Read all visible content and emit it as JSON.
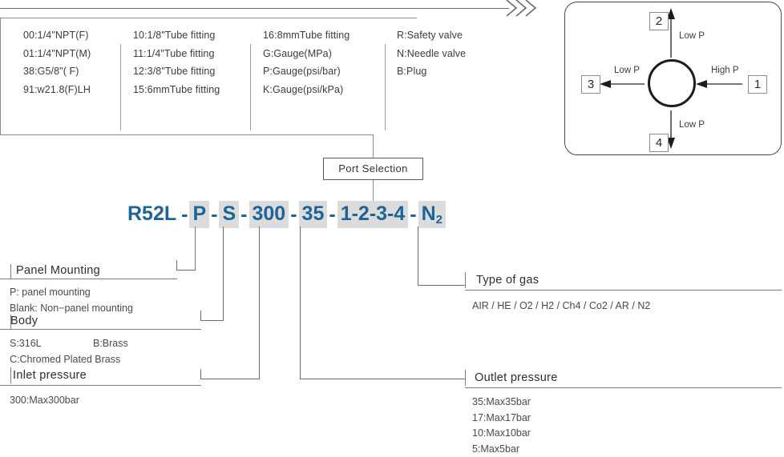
{
  "top_arrow": {
    "name": "flow-direction-arrow"
  },
  "options_table": {
    "columns": [
      {
        "header_none": true,
        "cells": [
          "00:1/4\"NPT(F)",
          "01:1/4\"NPT(M)",
          "38:G5/8\"( F)",
          "91:w21.8(F)LH"
        ]
      },
      {
        "header_none": true,
        "cells": [
          "10:1/8\"Tube fitting",
          "11:1/4\"Tube fitting",
          "12:3/8\"Tube fitting",
          "15:6mmTube fitting"
        ]
      },
      {
        "header_none": true,
        "cells": [
          "16:8mmTube fitting",
          "G:Gauge(MPa)",
          "P:Gauge(psi/bar)",
          "K:Gauge(psi/kPa)"
        ]
      },
      {
        "header_none": true,
        "cells": [
          "R:Safety valve",
          "N:Needle valve",
          "B:Plug"
        ]
      }
    ]
  },
  "schematic": {
    "ports": [
      {
        "id": "2",
        "label": "Low P"
      },
      {
        "id": "1",
        "label": "High P"
      },
      {
        "id": "3",
        "label": "Low P"
      },
      {
        "id": "4",
        "label": "Low P"
      }
    ],
    "center": "valve-body-circle"
  },
  "port_selection": {
    "label": "Port Selection"
  },
  "part_number": {
    "full": "R52L-P-S-300-35-1-2-3-4-N2",
    "segments": [
      {
        "text": "R52L",
        "highlight": false
      },
      {
        "text": "P",
        "highlight": true
      },
      {
        "text": "S",
        "highlight": true
      },
      {
        "text": "300",
        "highlight": true
      },
      {
        "text": "35",
        "highlight": true
      },
      {
        "text": "1-2-3-4",
        "highlight": true
      },
      {
        "text": "N",
        "sub": "2",
        "highlight": true
      }
    ],
    "separator": "-"
  },
  "callouts": {
    "panel_mounting": {
      "title": "Panel Mounting",
      "lines": [
        "P: panel mounting",
        "Blank: Non−panel mounting"
      ]
    },
    "body": {
      "title": "Body",
      "line1_a": "S:316L",
      "line1_b": "B:Brass",
      "line2": "C:Chromed Plated Brass"
    },
    "inlet_pressure": {
      "title": "Inlet pressure",
      "lines": [
        "300:Max300bar"
      ]
    },
    "type_of_gas": {
      "title": "Type of gas",
      "lines": [
        "AIR / HE / O2  / H2  / Ch4 / Co2  / AR / N2"
      ]
    },
    "outlet_pressure": {
      "title": "Outlet pressure",
      "lines": [
        "35:Max35bar",
        "17:Max17bar",
        "10:Max10bar",
        "5:Max5bar"
      ]
    }
  },
  "colors": {
    "accent_blue": "#1b6599",
    "highlight_gray": "#dcdcdc",
    "line_gray": "#7d7d7d",
    "text_dark": "#2e2e2e"
  }
}
